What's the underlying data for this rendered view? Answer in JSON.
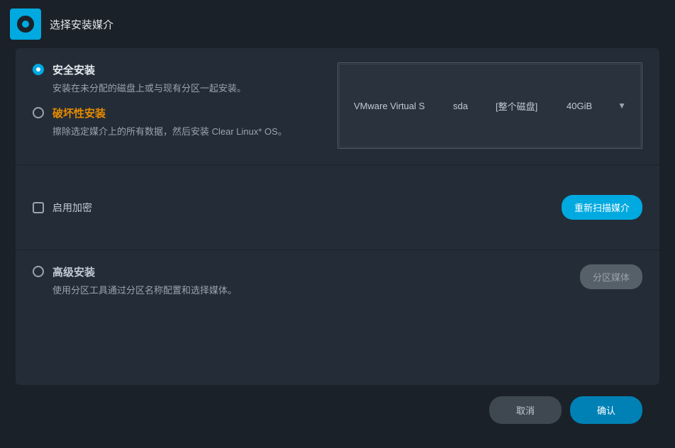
{
  "header": {
    "title": "选择安装媒介"
  },
  "options": {
    "safe": {
      "title": "安全安装",
      "desc": "安装在未分配的磁盘上或与现有分区一起安装。"
    },
    "destructive": {
      "title": "破坏性安装",
      "desc": "擦除选定媒介上的所有数据，然后安装 Clear Linux* OS。"
    },
    "advanced": {
      "title": "高级安装",
      "desc": "使用分区工具通过分区名称配置和选择媒体。"
    }
  },
  "disk": {
    "name": "VMware Virtual S",
    "device": "sda",
    "scope": "[整个磁盘]",
    "size": "40GiB"
  },
  "encryption": {
    "label": "启用加密"
  },
  "buttons": {
    "rescan": "重新扫描媒介",
    "partition": "分区媒体",
    "cancel": "取消",
    "confirm": "确认"
  }
}
